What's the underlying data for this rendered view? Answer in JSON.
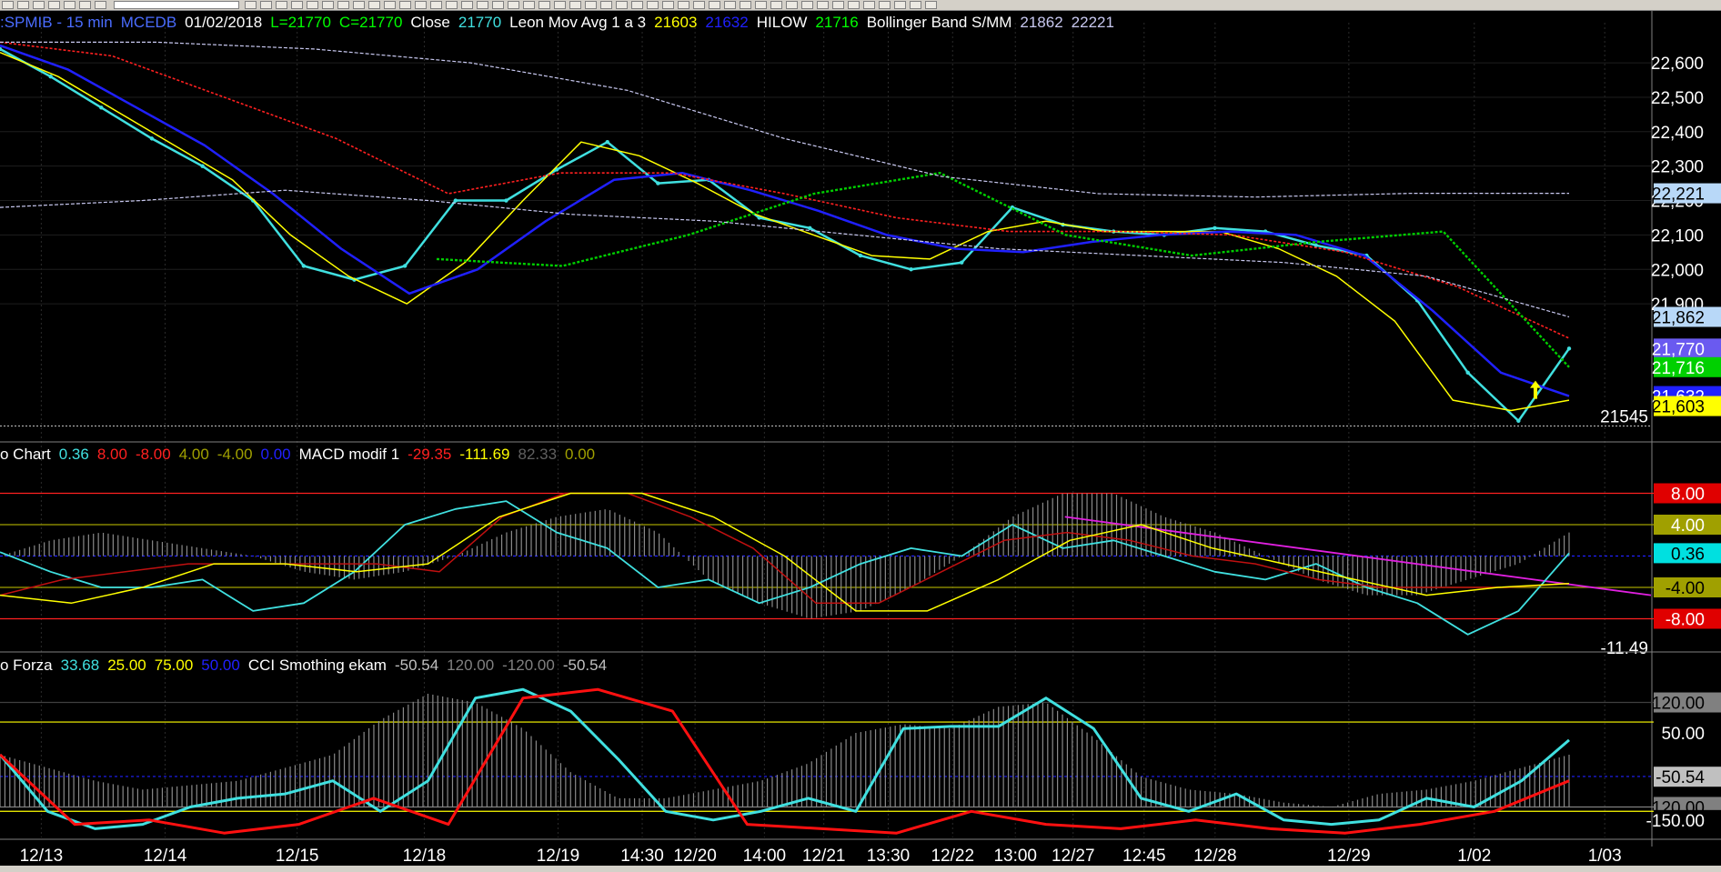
{
  "toolbar": {
    "button_count": 52
  },
  "colors": {
    "bg": "#000000",
    "price": "#40e0e0",
    "mov_fast": "#ffff00",
    "mov_mid": "#2020ff",
    "mov_slow": "#ff2020",
    "hilow": "#00d000",
    "boll": "#c8c8f0",
    "grid": "#303030",
    "macd_fill": "#a0a0a0",
    "trend": "#e020e0"
  },
  "header": {
    "main": [
      {
        "text": ":SPMIB - 15 min",
        "color": "#4a6cff"
      },
      {
        "text": "MCEDB",
        "color": "#4a6cff"
      },
      {
        "text": "01/02/2018",
        "color": "#ffffff"
      },
      {
        "text": "L=21770",
        "color": "#00ff00"
      },
      {
        "text": "C=21770",
        "color": "#00ff00"
      },
      {
        "text": "Close",
        "color": "#ffffff"
      },
      {
        "text": "21770",
        "color": "#40e0e0"
      },
      {
        "text": "Leon Mov Avg 1 a 3",
        "color": "#ffffff"
      },
      {
        "text": "21603",
        "color": "#ffff00"
      },
      {
        "text": "21632",
        "color": "#2020ff"
      },
      {
        "text": "HILOW",
        "color": "#ffffff"
      },
      {
        "text": "21716",
        "color": "#00ff00"
      },
      {
        "text": "Bollinger Band S/MM",
        "color": "#ffffff"
      },
      {
        "text": "21862",
        "color": "#c8c8f0"
      },
      {
        "text": "22221",
        "color": "#c8c8f0"
      }
    ],
    "macd": [
      {
        "text": "o Chart",
        "color": "#ffffff"
      },
      {
        "text": "0.36",
        "color": "#40e0e0"
      },
      {
        "text": "8.00",
        "color": "#ff2020"
      },
      {
        "text": "-8.00",
        "color": "#ff2020"
      },
      {
        "text": "4.00",
        "color": "#a0a000"
      },
      {
        "text": "-4.00",
        "color": "#a0a000"
      },
      {
        "text": "0.00",
        "color": "#2020ff"
      },
      {
        "text": "MACD modif 1",
        "color": "#ffffff"
      },
      {
        "text": "-29.35",
        "color": "#ff2020"
      },
      {
        "text": "-111.69",
        "color": "#ffff00"
      },
      {
        "text": "82.33",
        "color": "#606060"
      },
      {
        "text": "0.00",
        "color": "#a0a000"
      }
    ],
    "cci": [
      {
        "text": "o Forza",
        "color": "#ffffff"
      },
      {
        "text": "33.68",
        "color": "#40e0e0"
      },
      {
        "text": "25.00",
        "color": "#ffff00"
      },
      {
        "text": "75.00",
        "color": "#ffff00"
      },
      {
        "text": "50.00",
        "color": "#2020ff"
      },
      {
        "text": "CCI Smothing ekam",
        "color": "#ffffff"
      },
      {
        "text": "-50.54",
        "color": "#c0c0c0"
      },
      {
        "text": "120.00",
        "color": "#808080"
      },
      {
        "text": "-120.00",
        "color": "#808080"
      },
      {
        "text": "-50.54",
        "color": "#c0c0c0"
      }
    ]
  },
  "chart_data": [
    {
      "type": "line",
      "title": ":SPMIB - 15 min",
      "ylim": [
        21520,
        22690
      ],
      "yticks": [
        21900,
        22000,
        22100,
        22200,
        22300,
        22400,
        22500,
        22600
      ],
      "ytick_labels": [
        "21,900",
        "22,000",
        "22,100",
        "22,200",
        "22,300",
        "22,400",
        "22,500",
        "22,600"
      ],
      "x": [
        0,
        5,
        10,
        15,
        20,
        25,
        30,
        35,
        40,
        45,
        50,
        55,
        60,
        65,
        70,
        75,
        80,
        85,
        90,
        95,
        100
      ],
      "series": [
        {
          "name": "Close",
          "values": [
            22640,
            22560,
            22470,
            22380,
            22300,
            22200,
            22010,
            21970,
            22010,
            22200,
            22200,
            22290,
            22370,
            22250,
            22260,
            22150,
            22120,
            22040,
            22000,
            22020,
            22180,
            22130,
            22110,
            22100,
            22120,
            22110,
            22070,
            22040,
            21910,
            21700,
            21560,
            21770
          ]
        },
        {
          "values": [
            22630,
            22560,
            22460,
            22360,
            22260,
            22100,
            21980,
            21900,
            22020,
            22200,
            22370,
            22330,
            22250,
            22160,
            22100,
            22040,
            22030,
            22110,
            22140,
            22110,
            22110,
            22110,
            22060,
            21980,
            21850,
            21620,
            21590,
            21620
          ]
        },
        {
          "values": [
            22650,
            22580,
            22470,
            22360,
            22220,
            22060,
            21930,
            22000,
            22140,
            22260,
            22280,
            22230,
            22170,
            22100,
            22060,
            22050,
            22080,
            22100,
            22110,
            22100,
            22040,
            21880,
            21700,
            21632
          ]
        },
        {
          "values": [
            22660,
            22620,
            22500,
            22380,
            22220,
            22280,
            22280,
            22220,
            22150,
            22110,
            22110,
            22100,
            22050,
            21950,
            21800
          ]
        },
        {
          "name": "HILOW",
          "values": [
            22030,
            22010,
            22100,
            22220,
            22280,
            22100,
            22040,
            22080,
            22110,
            21716
          ]
        },
        {
          "values": [
            22660,
            22660,
            22640,
            22600,
            22520,
            22380,
            22270,
            22220,
            22210,
            22221,
            22221
          ]
        },
        {
          "values": [
            22180,
            22200,
            22230,
            22200,
            22160,
            22140,
            22100,
            22060,
            22040,
            22020,
            21980,
            21862
          ]
        }
      ],
      "level_label": "21545",
      "right_labels": [
        {
          "text": "22,221",
          "value": 22221,
          "bg": "#b8d8f8",
          "fg": "#000000"
        },
        {
          "text": "21,862",
          "value": 21862,
          "bg": "#b8d8f8",
          "fg": "#000000"
        },
        {
          "text": "21,770",
          "value": 21770,
          "bg": "#6a5af0",
          "fg": "#ffffff"
        },
        {
          "text": "21,716",
          "value": 21716,
          "bg": "#00d000",
          "fg": "#ffffff"
        },
        {
          "text": "21,632",
          "value": 21632,
          "bg": "#2020ff",
          "fg": "#ffffff"
        },
        {
          "text": "21,603",
          "value": 21603,
          "bg": "#ffff00",
          "fg": "#000000"
        }
      ]
    },
    {
      "type": "line",
      "title": "MACD modif 1",
      "ylim": [
        -12,
        12
      ],
      "hlines": [
        {
          "value": 8,
          "color": "#ff2020"
        },
        {
          "value": 4,
          "color": "#a0a000"
        },
        {
          "value": 0,
          "color": "#2020ff",
          "dash": true
        },
        {
          "value": -4,
          "color": "#a0a000"
        },
        {
          "value": -8,
          "color": "#ff2020"
        }
      ],
      "series": [
        {
          "name": "0.36",
          "values": [
            0.5,
            -2,
            -4,
            -4,
            -3,
            -7,
            -6,
            -2,
            4,
            6,
            7,
            3,
            1,
            -4,
            -3,
            -6,
            -4,
            -1,
            1,
            0,
            4,
            1,
            2,
            0,
            -2,
            -3,
            -1,
            -4,
            -6,
            -10,
            -7,
            0.36
          ]
        },
        {
          "values": [
            -5,
            -3,
            -2,
            -1,
            -1,
            -1,
            -1,
            -2,
            5,
            8,
            8,
            5,
            1,
            -6,
            -6,
            -2,
            2,
            3,
            2,
            0,
            -1,
            -3,
            -4,
            -4,
            -4,
            -3.5
          ]
        },
        {
          "values": [
            -5,
            -6,
            -4,
            -1,
            -1,
            -2,
            -1,
            5,
            8,
            8,
            5,
            0,
            -7,
            -7,
            -3,
            2,
            4,
            1,
            -1,
            -3,
            -5,
            -4,
            -3.5
          ]
        }
      ],
      "histogram": [
        0,
        2,
        3,
        2,
        1,
        0,
        -2,
        -3,
        -2,
        0,
        3,
        5,
        6,
        3,
        -3,
        -6,
        -8,
        -7,
        -4,
        0,
        5,
        8,
        8,
        5,
        3,
        0,
        -3,
        -5,
        -5,
        -3,
        -1,
        3
      ],
      "trendline": {
        "from": [
          64.5,
          5
        ],
        "to": [
          100,
          -5
        ]
      },
      "right_labels": [
        {
          "text": "8.00",
          "value": 8,
          "bg": "#e00000",
          "fg": "#ffffff"
        },
        {
          "text": "4.00",
          "value": 4,
          "bg": "#a0a000",
          "fg": "#ffffff"
        },
        {
          "text": "0.36",
          "value": 0.36,
          "bg": "#00e0e0",
          "fg": "#000000"
        },
        {
          "text": "-4.00",
          "value": -4,
          "bg": "#a0a000",
          "fg": "#000000"
        },
        {
          "text": "-8.00",
          "value": -8,
          "bg": "#e00000",
          "fg": "#ffffff"
        }
      ],
      "level_label": "-11.49"
    },
    {
      "type": "line",
      "title": "CCI Smothing ekam",
      "ylim": [
        -190,
        190
      ],
      "hlines": [
        {
          "value": 120,
          "color": "#404040"
        },
        {
          "value": 75,
          "color": "#ffff00"
        },
        {
          "value": -50,
          "color": "#2020ff",
          "dash": true
        },
        {
          "value": -120,
          "color": "#808080"
        },
        {
          "value": -130,
          "color": "#ffff00"
        }
      ],
      "series": [
        {
          "name": "33.68",
          "values": [
            0,
            -130,
            -170,
            -160,
            -120,
            -100,
            -90,
            -60,
            -130,
            -60,
            130,
            150,
            100,
            -10,
            -130,
            -150,
            -130,
            -100,
            -130,
            60,
            65,
            65,
            130,
            60,
            -100,
            -130,
            -90,
            -150,
            -160,
            -150,
            -100,
            -120,
            -60,
            33.68
          ]
        },
        {
          "values": [
            0,
            -160,
            -150,
            -180,
            -160,
            -100,
            -160,
            130,
            150,
            100,
            -160,
            -170,
            -180,
            -130,
            -160,
            -170,
            -150,
            -170,
            -180,
            -160,
            -130,
            -60
          ]
        }
      ],
      "histogram": [
        0,
        -30,
        -60,
        -80,
        -70,
        -60,
        -30,
        0,
        80,
        140,
        120,
        60,
        -40,
        -100,
        -100,
        -80,
        -60,
        -20,
        50,
        70,
        60,
        110,
        120,
        40,
        -50,
        -80,
        -90,
        -110,
        -120,
        -90,
        -80,
        -60,
        -30,
        0
      ],
      "right_labels": [
        {
          "text": "120.00",
          "value": 120,
          "bg": "#808080",
          "fg": "#000000"
        },
        {
          "text": "50.00",
          "value": 50,
          "bg": "#000000",
          "fg": "#ffffff"
        },
        {
          "text": "-50.54",
          "value": -50.54,
          "bg": "#c0c0c0",
          "fg": "#000000"
        },
        {
          "text": "-120.00",
          "value": -120,
          "bg": "#808080",
          "fg": "#000000"
        },
        {
          "text": "-150.00",
          "value": -150,
          "bg": "#000000",
          "fg": "#ffffff"
        }
      ]
    }
  ],
  "x_axis": {
    "ticks": [
      {
        "text": "12/13",
        "pos": 2.5
      },
      {
        "text": "12/14",
        "pos": 10
      },
      {
        "text": "12/15",
        "pos": 18
      },
      {
        "text": "12/18",
        "pos": 25.7
      },
      {
        "text": "12/19",
        "pos": 33.8
      },
      {
        "text": "14:30",
        "pos": 38.9
      },
      {
        "text": "12/20",
        "pos": 42.1
      },
      {
        "text": "14:00",
        "pos": 46.3
      },
      {
        "text": "12/21",
        "pos": 49.9
      },
      {
        "text": "13:30",
        "pos": 53.8
      },
      {
        "text": "12/22",
        "pos": 57.7
      },
      {
        "text": "13:00",
        "pos": 61.5
      },
      {
        "text": "12/27",
        "pos": 65
      },
      {
        "text": "12:45",
        "pos": 69.3
      },
      {
        "text": "12/28",
        "pos": 73.6
      },
      {
        "text": "12/29",
        "pos": 81.7
      },
      {
        "text": "1/02",
        "pos": 89.3
      },
      {
        "text": "1/03",
        "pos": 97.2
      }
    ]
  }
}
